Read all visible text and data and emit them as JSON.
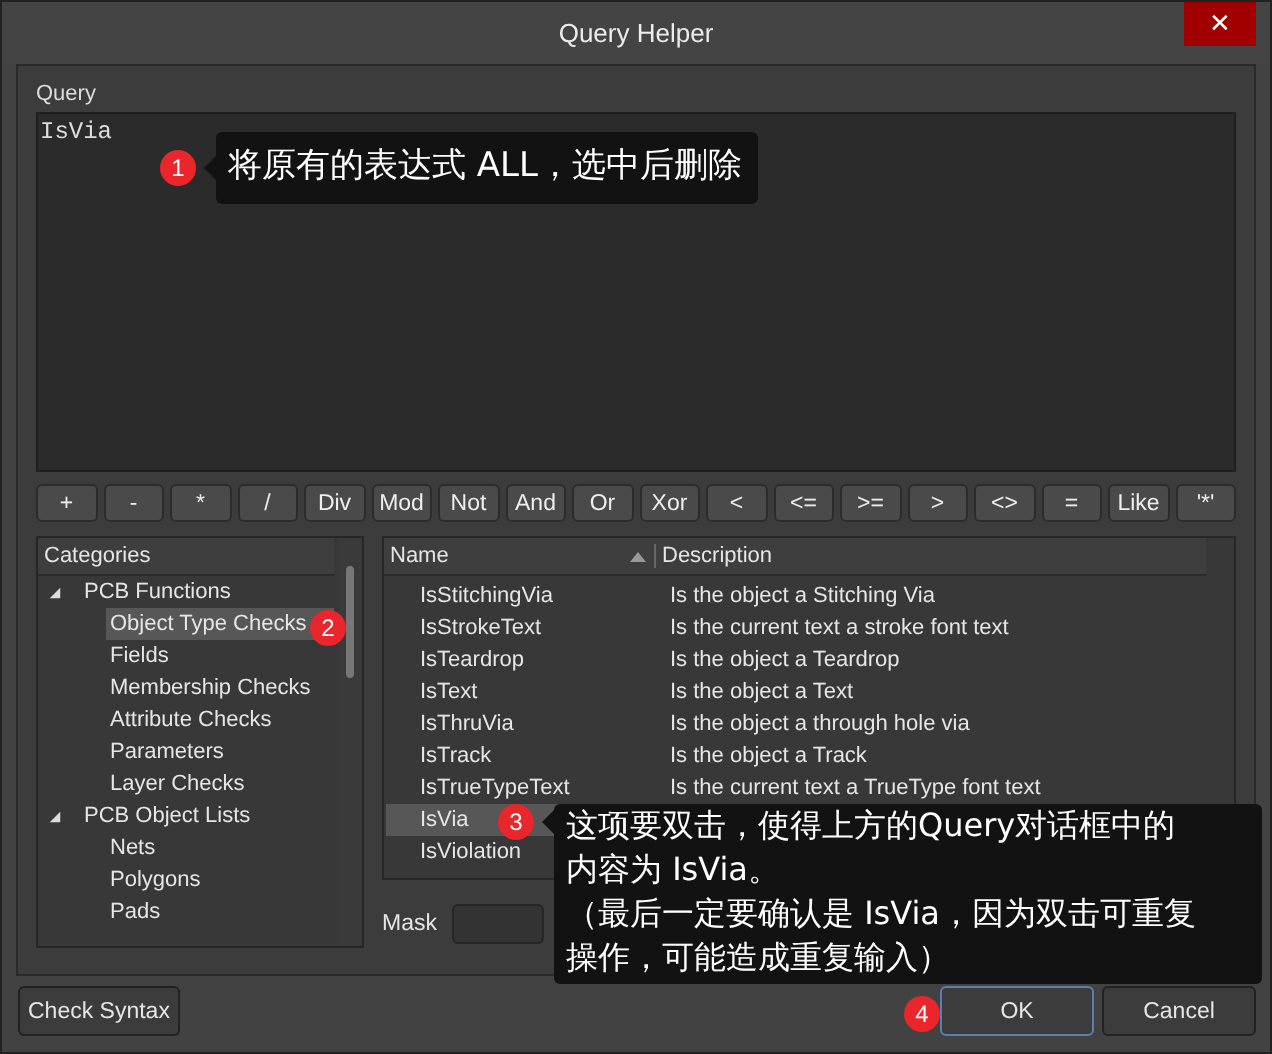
{
  "window": {
    "title": "Query Helper",
    "close": "✕"
  },
  "query": {
    "label": "Query",
    "value": "IsVia"
  },
  "operators": [
    "+",
    "-",
    "*",
    "/",
    "Div",
    "Mod",
    "Not",
    "And",
    "Or",
    "Xor",
    "<",
    "<=",
    ">=",
    ">",
    "<>",
    "=",
    "Like",
    "'*'"
  ],
  "categories": {
    "title": "Categories",
    "items": [
      {
        "label": "PCB Functions",
        "expanded": true,
        "selected": false,
        "children": [
          {
            "label": "Object Type Checks",
            "selected": true
          },
          {
            "label": "Fields",
            "selected": false
          },
          {
            "label": "Membership Checks",
            "selected": false
          },
          {
            "label": "Attribute Checks",
            "selected": false
          },
          {
            "label": "Parameters",
            "selected": false
          },
          {
            "label": "Layer Checks",
            "selected": false
          }
        ]
      },
      {
        "label": "PCB Object Lists",
        "expanded": true,
        "selected": false,
        "children": [
          {
            "label": "Nets",
            "selected": false
          },
          {
            "label": "Polygons",
            "selected": false
          },
          {
            "label": "Pads",
            "selected": false
          }
        ]
      }
    ]
  },
  "table": {
    "columns": [
      "Name",
      "Description"
    ],
    "rows": [
      {
        "name": "IsStitchingVia",
        "description": "Is the object a Stitching Via",
        "selected": false
      },
      {
        "name": "IsStrokeText",
        "description": "Is the current text a stroke font text",
        "selected": false
      },
      {
        "name": "IsTeardrop",
        "description": "Is the object a Teardrop",
        "selected": false
      },
      {
        "name": "IsText",
        "description": "Is the object a Text",
        "selected": false
      },
      {
        "name": "IsThruVia",
        "description": "Is the object a through hole via",
        "selected": false
      },
      {
        "name": "IsTrack",
        "description": "Is the object a Track",
        "selected": false
      },
      {
        "name": "IsTrueTypeText",
        "description": "Is the current text a TrueType font text",
        "selected": false
      },
      {
        "name": "IsVia",
        "selected": true
      },
      {
        "name": "IsViolation",
        "selected": false
      }
    ]
  },
  "mask": {
    "label": "Mask"
  },
  "buttons": {
    "check_syntax": "Check Syntax",
    "ok": "OK",
    "cancel": "Cancel"
  },
  "annotations": [
    {
      "number": "1",
      "lines": [
        "将原有的表达式 ALL，选中后删除"
      ]
    },
    {
      "number": "2"
    },
    {
      "number": "3",
      "lines": [
        "这项要双击，使得上方的Query对话框中的内容为 IsVia。",
        "（最后一定要确认是 IsVia，因为双击可重复操作，可能造成重复输入）"
      ]
    },
    {
      "number": "4"
    }
  ]
}
